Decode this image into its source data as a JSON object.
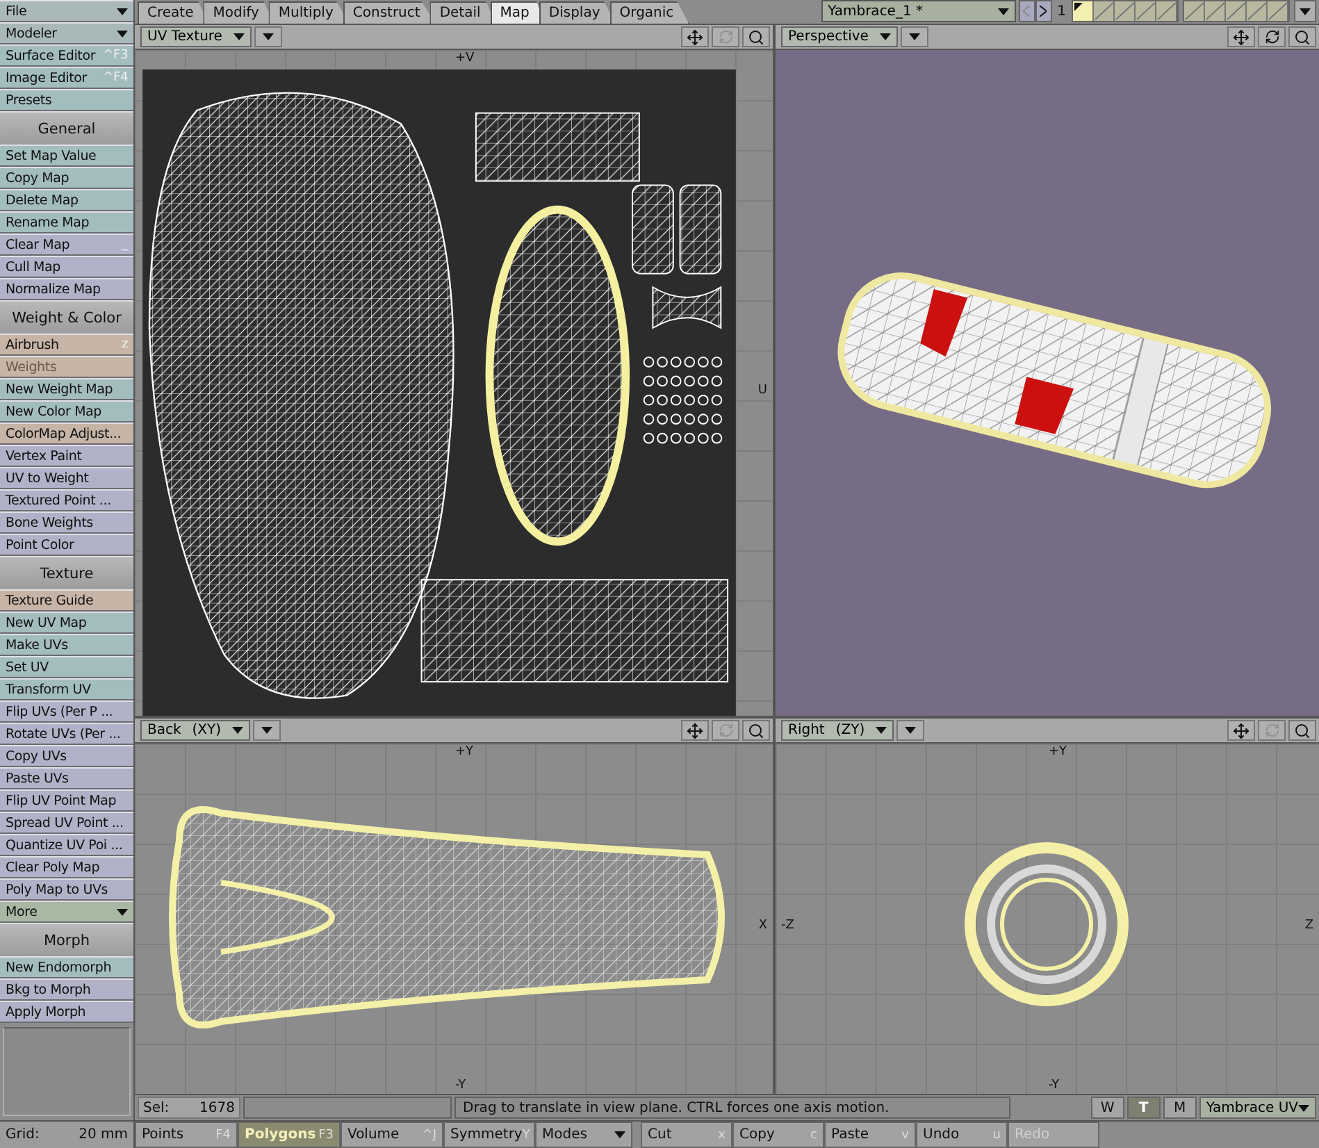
{
  "sidebar": {
    "items": [
      {
        "kind": "dropdown",
        "label": "File",
        "color": "#a9b9b9"
      },
      {
        "kind": "dropdown",
        "label": "Modeler",
        "color": "#a9b9b9"
      },
      {
        "kind": "button",
        "label": "Surface Editor",
        "shortcut": "^F3",
        "color": "#a3bcbe",
        "disabled": false
      },
      {
        "kind": "button",
        "label": "Image Editor",
        "shortcut": "^F4",
        "color": "#a3bcbe",
        "disabled": false
      },
      {
        "kind": "button",
        "label": "Presets",
        "color": "#a3bcbe",
        "disabled": false
      },
      {
        "kind": "header",
        "label": "General"
      },
      {
        "kind": "button",
        "label": "Set Map Value",
        "color": "#a3bcbe",
        "disabled": false
      },
      {
        "kind": "button",
        "label": "Copy Map",
        "color": "#a3bcbe",
        "disabled": false
      },
      {
        "kind": "button",
        "label": "Delete Map",
        "color": "#a3bcbe",
        "disabled": false
      },
      {
        "kind": "button",
        "label": "Rename Map",
        "color": "#a3bcbe",
        "disabled": false
      },
      {
        "kind": "button",
        "label": "Clear Map",
        "shortcut": "_",
        "color": "#b1b1c7",
        "disabled": false
      },
      {
        "kind": "button",
        "label": "Cull Map",
        "color": "#b1b1c7",
        "disabled": false
      },
      {
        "kind": "button",
        "label": "Normalize Map",
        "color": "#b1b1c7",
        "disabled": false
      },
      {
        "kind": "header",
        "label": "Weight & Color"
      },
      {
        "kind": "button",
        "label": "Airbrush",
        "shortcut": "z",
        "color": "#c6b5a6",
        "disabled": false
      },
      {
        "kind": "button",
        "label": "Weights",
        "color": "#c6b5a6",
        "disabled": true
      },
      {
        "kind": "button",
        "label": "New Weight Map",
        "color": "#a3bcbe",
        "disabled": false
      },
      {
        "kind": "button",
        "label": "New Color Map",
        "color": "#a3bcbe",
        "disabled": false
      },
      {
        "kind": "button",
        "label": "ColorMap Adjust...",
        "color": "#c6b5a6",
        "disabled": false
      },
      {
        "kind": "button",
        "label": "Vertex Paint",
        "color": "#b1b1c7",
        "disabled": false
      },
      {
        "kind": "button",
        "label": "UV to Weight",
        "color": "#b1b1c7",
        "disabled": false
      },
      {
        "kind": "button",
        "label": "Textured Point ...",
        "color": "#b1b1c7",
        "disabled": false
      },
      {
        "kind": "button",
        "label": "Bone Weights",
        "color": "#b1b1c7",
        "disabled": false
      },
      {
        "kind": "button",
        "label": "Point Color",
        "color": "#b1b1c7",
        "disabled": false
      },
      {
        "kind": "header",
        "label": "Texture"
      },
      {
        "kind": "button",
        "label": "Texture Guide",
        "color": "#c6b5a6",
        "disabled": false
      },
      {
        "kind": "button",
        "label": "New UV Map",
        "color": "#a3bcbe",
        "disabled": false
      },
      {
        "kind": "button",
        "label": "Make UVs",
        "color": "#a3bcbe",
        "disabled": false
      },
      {
        "kind": "button",
        "label": "Set UV",
        "color": "#a3bcbe",
        "disabled": false
      },
      {
        "kind": "button",
        "label": "Transform UV",
        "color": "#a3bcbe",
        "disabled": false
      },
      {
        "kind": "button",
        "label": "Flip UVs (Per P ...",
        "color": "#b1b1c7",
        "disabled": false
      },
      {
        "kind": "button",
        "label": "Rotate UVs (Per ...",
        "color": "#b1b1c7",
        "disabled": false
      },
      {
        "kind": "button",
        "label": "Copy UVs",
        "color": "#b1b1c7",
        "disabled": false
      },
      {
        "kind": "button",
        "label": "Paste UVs",
        "color": "#b1b1c7",
        "disabled": false
      },
      {
        "kind": "button",
        "label": "Flip UV Point Map",
        "color": "#b1b1c7",
        "disabled": false
      },
      {
        "kind": "button",
        "label": "Spread UV Point ...",
        "color": "#b1b1c7",
        "disabled": false
      },
      {
        "kind": "button",
        "label": "Quantize UV Poi ...",
        "color": "#b1b1c7",
        "disabled": false
      },
      {
        "kind": "button",
        "label": "Clear Poly Map",
        "color": "#b1b1c7",
        "disabled": false
      },
      {
        "kind": "button",
        "label": "Poly Map to UVs",
        "color": "#b1b1c7",
        "disabled": false
      },
      {
        "kind": "dropdown",
        "label": "More",
        "color": "#a9b8a2"
      },
      {
        "kind": "header",
        "label": "Morph"
      },
      {
        "kind": "button",
        "label": "New Endomorph",
        "color": "#a3bcbe",
        "disabled": false
      },
      {
        "kind": "button",
        "label": "Bkg to Morph",
        "color": "#b1b1c7",
        "disabled": false
      },
      {
        "kind": "button",
        "label": "Apply Morph",
        "color": "#b1b1c7",
        "disabled": false
      }
    ],
    "grid": {
      "label": "Grid:",
      "value": "20 mm"
    }
  },
  "tabs": [
    {
      "label": "Create",
      "selected": false
    },
    {
      "label": "Modify",
      "selected": false
    },
    {
      "label": "Multiply",
      "selected": false
    },
    {
      "label": "Construct",
      "selected": false
    },
    {
      "label": "Detail",
      "selected": false
    },
    {
      "label": "Map",
      "selected": true
    },
    {
      "label": "Display",
      "selected": false
    },
    {
      "label": "Organic",
      "selected": false
    }
  ],
  "object": {
    "name": "Yambrace_1 *",
    "layer_number": "1",
    "layers": [
      {
        "selected": true
      },
      {
        "selected": false
      },
      {
        "selected": false
      },
      {
        "selected": false
      },
      {
        "selected": false
      },
      {
        "selected": false
      },
      {
        "selected": false
      },
      {
        "selected": false
      },
      {
        "selected": false
      },
      {
        "selected": false
      }
    ]
  },
  "viewports": [
    {
      "kind": "uv",
      "view": "UV Texture",
      "rotate_enabled": false,
      "axes": {
        "top": "+V",
        "right": "U"
      }
    },
    {
      "kind": "perspective",
      "view": "Perspective",
      "rotate_enabled": true
    },
    {
      "kind": "back",
      "view": "Back",
      "plane": "(XY)",
      "rotate_enabled": false,
      "axes": {
        "top": "+Y",
        "right": "X",
        "bottom": "-Y"
      }
    },
    {
      "kind": "right",
      "view": "Right",
      "plane": "(ZY)",
      "rotate_enabled": false,
      "axes": {
        "top": "+Y",
        "left": "-Z",
        "right": "Z",
        "bottom": "-Y"
      }
    }
  ],
  "status": {
    "sel_label": "Sel:",
    "sel_count": "1678",
    "message": "Drag to translate in view plane. CTRL forces one axis motion.",
    "map_types": [
      {
        "label": "W",
        "selected": false
      },
      {
        "label": "T",
        "selected": true
      },
      {
        "label": "M",
        "selected": false
      }
    ],
    "map": "Yambrace UV"
  },
  "toolbar": [
    {
      "kind": "mode",
      "label": "Points",
      "shortcut": "F4",
      "selected": false,
      "disabled": false
    },
    {
      "kind": "mode",
      "label": "Polygons",
      "shortcut": "F3",
      "selected": true,
      "disabled": false
    },
    {
      "kind": "mode",
      "label": "Volume",
      "shortcut": "^J",
      "selected": false,
      "disabled": false
    },
    {
      "kind": "action",
      "label": "Symmetry",
      "shortcut": "Y",
      "selected": false,
      "disabled": false
    },
    {
      "kind": "dropdown",
      "label": "Modes",
      "selected": false,
      "disabled": false
    },
    {
      "kind": "action",
      "label": "Cut",
      "shortcut": "x",
      "selected": false,
      "disabled": false
    },
    {
      "kind": "action",
      "label": "Copy",
      "shortcut": "c",
      "selected": false,
      "disabled": false
    },
    {
      "kind": "action",
      "label": "Paste",
      "shortcut": "v",
      "selected": false,
      "disabled": false
    },
    {
      "kind": "action",
      "label": "Undo",
      "shortcut": "u",
      "selected": false,
      "disabled": false
    },
    {
      "kind": "action",
      "label": "Redo",
      "selected": false,
      "disabled": true
    }
  ]
}
